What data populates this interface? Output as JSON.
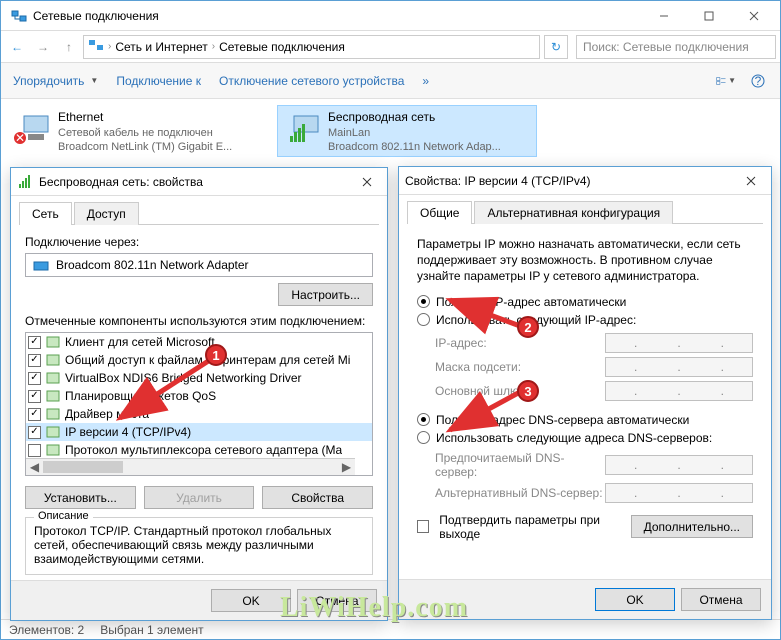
{
  "window": {
    "title": "Сетевые подключения",
    "breadcrumb": {
      "part1": "Сеть и Интернет",
      "part2": "Сетевые подключения"
    },
    "search_placeholder": "Поиск: Сетевые подключения",
    "toolbar": {
      "organize": "Упорядочить",
      "connect": "Подключение к",
      "disable": "Отключение сетевого устройства"
    },
    "connections": {
      "ethernet": {
        "name": "Ethernet",
        "status": "Сетевой кабель не подключен",
        "device": "Broadcom NetLink (TM) Gigabit E..."
      },
      "wifi": {
        "name": "Беспроводная сеть",
        "status": "MainLan",
        "device": "Broadcom 802.11n Network Adap..."
      }
    },
    "status": {
      "count": "Элементов: 2",
      "selected": "Выбран 1 элемент"
    }
  },
  "dlg_props": {
    "title": "Беспроводная сеть: свойства",
    "tabs": {
      "net": "Сеть",
      "access": "Доступ"
    },
    "connect_via": "Подключение через:",
    "adapter": "Broadcom 802.11n Network Adapter",
    "configure": "Настроить...",
    "components_label": "Отмеченные компоненты используются этим подключением:",
    "components": [
      "Клиент для сетей Microsoft",
      "Общий доступ к файлам и принтерам для сетей Mi",
      "VirtualBox NDIS6 Bridged Networking Driver",
      "Планировщик пакетов QoS",
      "Драйвер моста",
      "IP версии 4 (TCP/IPv4)",
      "Протокол мультиплексора сетевого адаптера (Ma"
    ],
    "install": "Установить...",
    "remove": "Удалить",
    "properties": "Свойства",
    "desc_legend": "Описание",
    "desc_text": "Протокол TCP/IP. Стандартный протокол глобальных сетей, обеспечивающий связь между различными взаимодействующими сетями.",
    "ok": "OK",
    "cancel": "Отмена"
  },
  "dlg_ipv4": {
    "title": "Свойства: IP версии 4 (TCP/IPv4)",
    "tabs": {
      "general": "Общие",
      "alt": "Альтернативная конфигурация"
    },
    "info": "Параметры IP можно назначать автоматически, если сеть поддерживает эту возможность. В противном случае узнайте параметры IP у сетевого администратора.",
    "ip_auto": "Получить IP-адрес автоматически",
    "ip_manual": "Использовать следующий IP-адрес:",
    "ip_addr": "IP-адрес:",
    "mask": "Маска подсети:",
    "gateway": "Основной шлюз:",
    "dns_auto": "Получить адрес DNS-сервера автоматически",
    "dns_manual": "Использовать следующие адреса DNS-серверов:",
    "dns_pref": "Предпочитаемый DNS-сервер:",
    "dns_alt": "Альтернативный DNS-сервер:",
    "confirm": "Подтвердить параметры при выходе",
    "advanced": "Дополнительно...",
    "ok": "OK",
    "cancel": "Отмена"
  },
  "watermark": "LiWiHelp.com"
}
